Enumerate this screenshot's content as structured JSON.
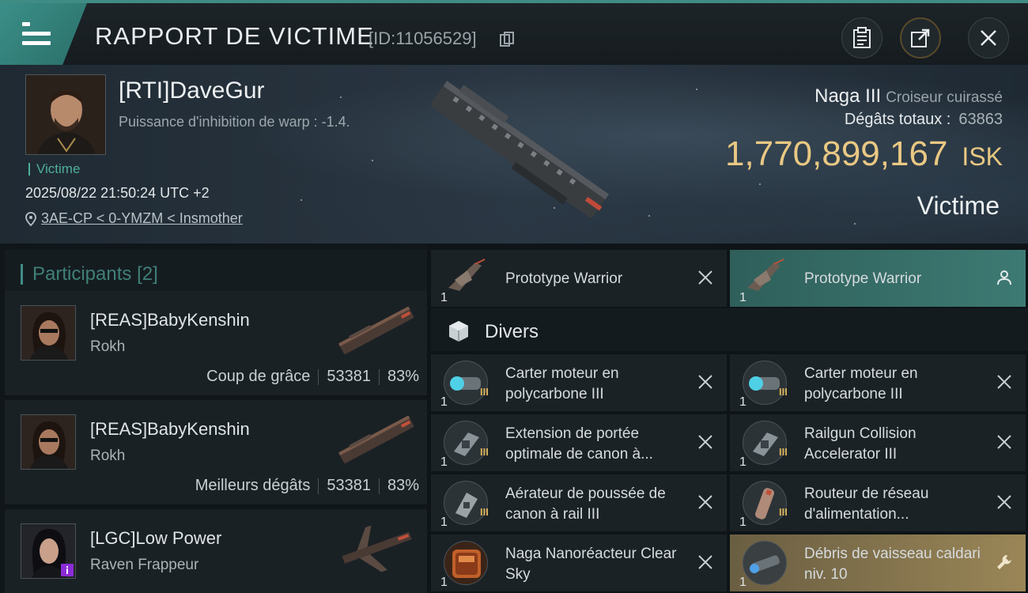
{
  "header": {
    "title": "RAPPORT DE VICTIME",
    "report_id": "[ID:11056529]"
  },
  "victim": {
    "name": "[RTI]DaveGur",
    "subtitle": "Puissance d'inhibition de warp : -1.4.",
    "role_tag": "Victime",
    "datetime": "2025/08/22 21:50:24 UTC +2",
    "location": "3AE-CP < 0-YMZM < Insmother",
    "ship_name": "Naga III",
    "ship_class": "Croiseur cuirassé",
    "damage_label": "Dégâts totaux :",
    "damage_value": "63863",
    "isk_amount": "1,770,899,167",
    "isk_unit": "ISK",
    "status": "Victime"
  },
  "participants": {
    "label": "Participants",
    "count": "[2]",
    "rows": [
      {
        "name": "[REAS]BabyKenshin",
        "ship": "Rokh",
        "stat_label": "Coup de grâce",
        "damage": "53381",
        "percent": "83%"
      },
      {
        "name": "[REAS]BabyKenshin",
        "ship": "Rokh",
        "stat_label": "Meilleurs dégâts",
        "damage": "53381",
        "percent": "83%"
      },
      {
        "name": "[LGC]Low Power",
        "ship": "Raven Frappeur",
        "stat_label": "",
        "damage": "",
        "percent": ""
      }
    ]
  },
  "items": {
    "top_row": [
      {
        "qty": "1",
        "name": "Prototype Warrior",
        "action": "close-icon"
      },
      {
        "qty": "1",
        "name": "Prototype Warrior",
        "action": "person-icon"
      }
    ],
    "section_label": "Divers",
    "grid": [
      {
        "qty": "1",
        "tier": "III",
        "name": "Carter moteur en polycarbone III"
      },
      {
        "qty": "1",
        "tier": "III",
        "name": "Carter moteur en polycarbone III"
      },
      {
        "qty": "1",
        "tier": "III",
        "name": "Extension de portée optimale de canon à..."
      },
      {
        "qty": "1",
        "tier": "III",
        "name": "Railgun Collision Accelerator III"
      },
      {
        "qty": "1",
        "tier": "III",
        "name": "Aérateur de poussée de canon à rail III"
      },
      {
        "qty": "1",
        "tier": "III",
        "name": "Routeur de réseau d'alimentation..."
      },
      {
        "qty": "1",
        "tier": "",
        "name": "Naga Nanoréacteur Clear Sky"
      },
      {
        "qty": "1",
        "tier": "",
        "name": "Débris de vaisseau caldari niv. 10"
      }
    ]
  },
  "colors": {
    "accent": "#3f8c85",
    "isk": "#e9c883",
    "tier": "#d9b25a",
    "victim_tag": "#4fae9a"
  }
}
